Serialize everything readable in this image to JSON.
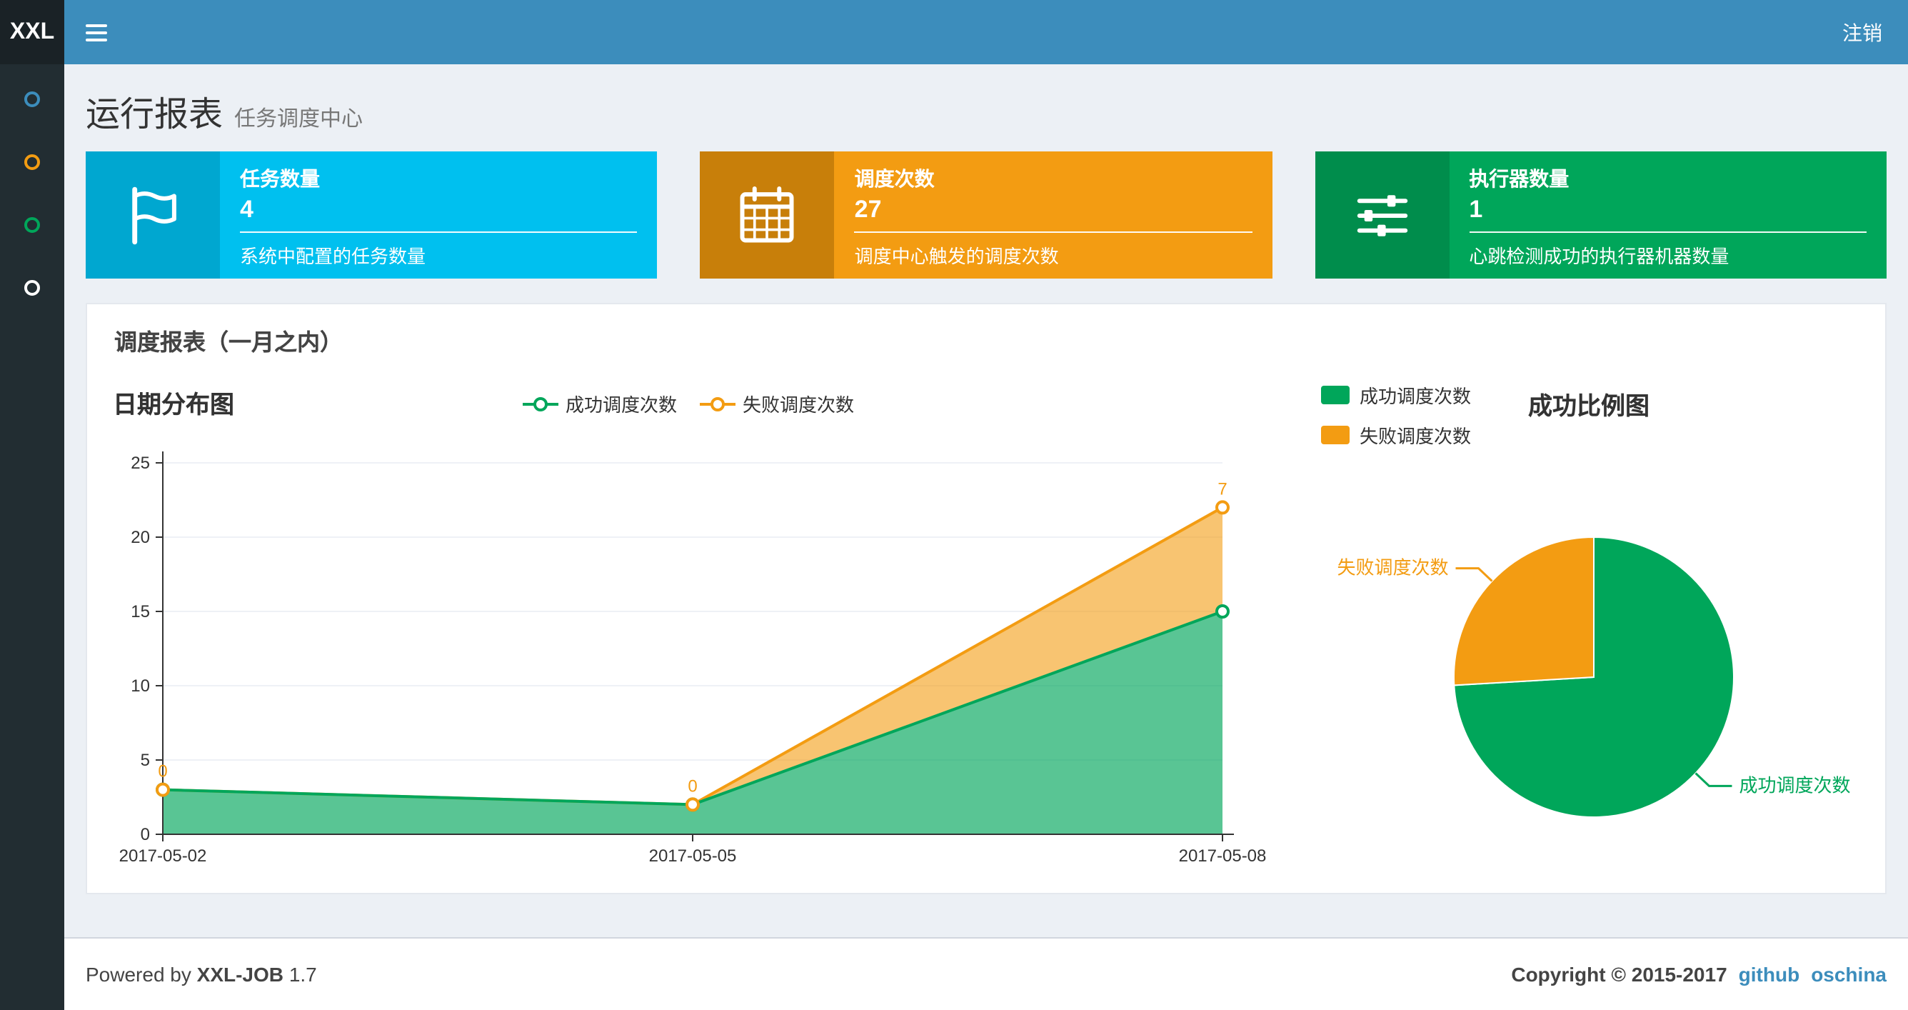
{
  "navbar": {
    "logo": "XXL",
    "logout_label": "注销",
    "bg_color": "#3c8dbc",
    "logo_bg_color": "#1a2226"
  },
  "sidebar": {
    "bg_color": "#222d32",
    "items": [
      {
        "icon": "circle-icon",
        "color": "#3c8dbc"
      },
      {
        "icon": "circle-icon",
        "color": "#f39c12"
      },
      {
        "icon": "circle-icon",
        "color": "#00a65a"
      },
      {
        "icon": "circle-icon",
        "color": "#ffffff"
      }
    ]
  },
  "header": {
    "title": "运行报表",
    "subtitle": "任务调度中心"
  },
  "info_boxes": [
    {
      "icon": "flag-icon",
      "title": "任务数量",
      "value": "4",
      "desc": "系统中配置的任务数量",
      "bg": "#00c0ef",
      "icon_bg": "#00a7d0"
    },
    {
      "icon": "calendar-icon",
      "title": "调度次数",
      "value": "27",
      "desc": "调度中心触发的调度次数",
      "bg": "#f39c12",
      "icon_bg": "#c87f0a"
    },
    {
      "icon": "sliders-icon",
      "title": "执行器数量",
      "value": "1",
      "desc": "心跳检测成功的执行器机器数量",
      "bg": "#00a65a",
      "icon_bg": "#008d4c"
    }
  ],
  "panel": {
    "title": "调度报表（一月之内）"
  },
  "chart_data": [
    {
      "type": "area",
      "title": "日期分布图",
      "stacked": true,
      "x": [
        "2017-05-02",
        "2017-05-05",
        "2017-05-08"
      ],
      "series": [
        {
          "name": "成功调度次数",
          "color": "#00a65a",
          "values": [
            3,
            2,
            15
          ]
        },
        {
          "name": "失败调度次数",
          "color": "#f39c12",
          "values": [
            0,
            0,
            7
          ],
          "point_labels": [
            "0",
            "0",
            "7"
          ]
        }
      ],
      "ylim": [
        0,
        25
      ],
      "yticks": [
        0,
        5,
        10,
        15,
        20,
        25
      ],
      "grid": true,
      "legend_position": "top-center"
    },
    {
      "type": "pie",
      "title": "成功比例图",
      "slices": [
        {
          "name": "成功调度次数",
          "value": 20,
          "color": "#00a65a"
        },
        {
          "name": "失败调度次数",
          "value": 7,
          "color": "#f39c12"
        }
      ],
      "legend_position": "top-left"
    }
  ],
  "footer": {
    "powered_by": "Powered by",
    "brand": "XXL-JOB",
    "version": "1.7",
    "copyright": "Copyright © 2015-2017",
    "links": [
      {
        "label": "github"
      },
      {
        "label": "oschina"
      }
    ]
  }
}
